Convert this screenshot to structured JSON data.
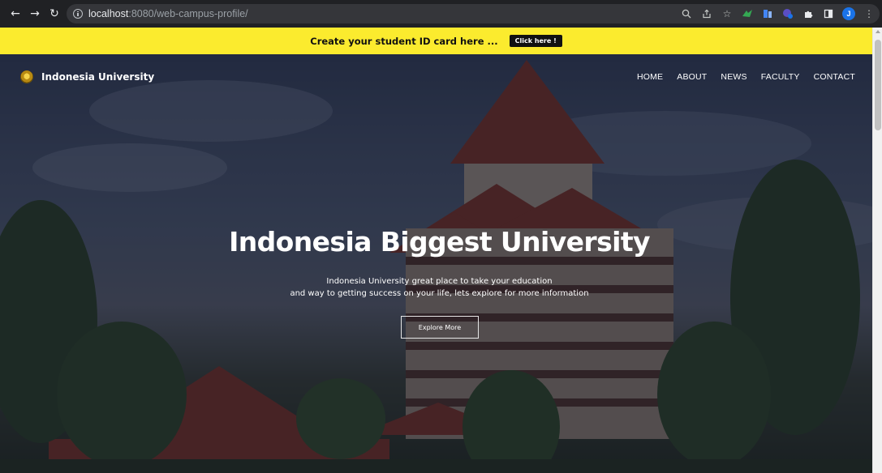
{
  "browser": {
    "url_host": "localhost",
    "url_rest": ":8080/web-campus-profile/",
    "profile_initial": "J"
  },
  "banner": {
    "text": "Create your student ID card here ...",
    "button_label": "Click here !",
    "color": "#fbeb2e"
  },
  "navbar": {
    "brand": "Indonesia University",
    "menu": [
      "HOME",
      "ABOUT",
      "NEWS",
      "FACULTY",
      "CONTACT"
    ]
  },
  "hero": {
    "title": "Indonesia Biggest University",
    "subtitle_line1": "Indonesia University great place to take your education",
    "subtitle_line2": "and way to getting success on your life, lets explore for more information",
    "button_label": "Explore More"
  }
}
